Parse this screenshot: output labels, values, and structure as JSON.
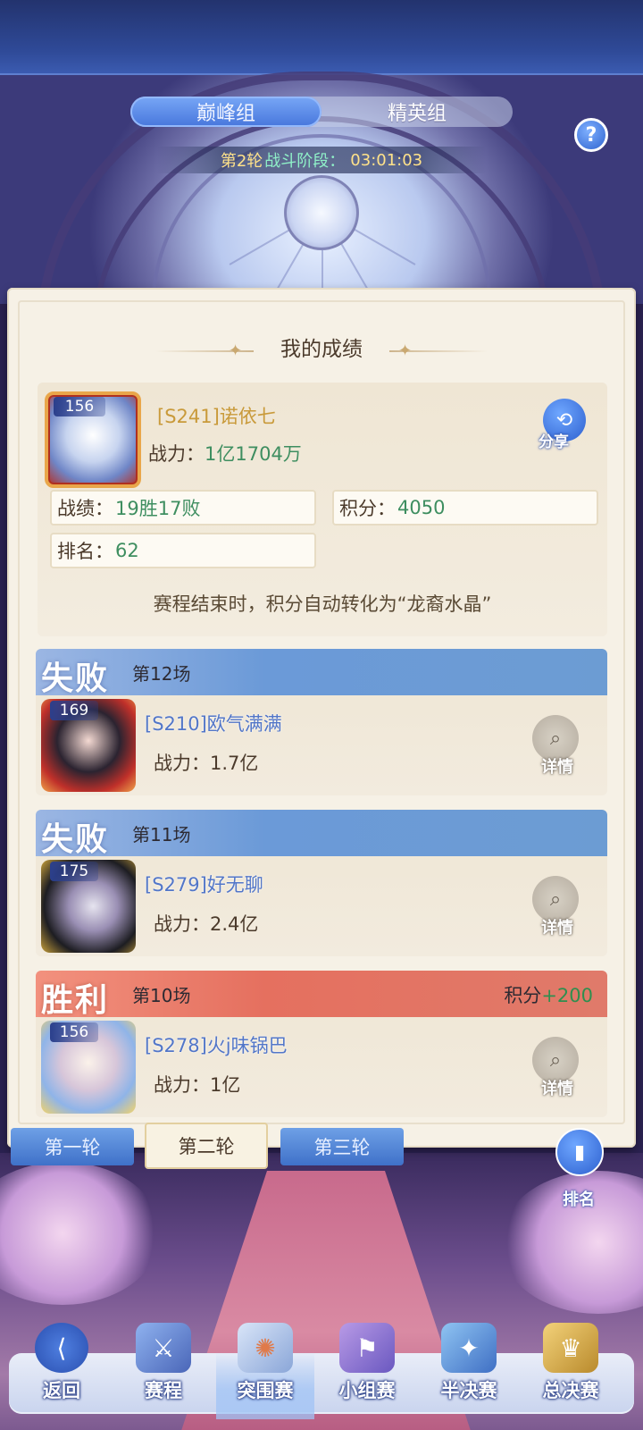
{
  "header": {
    "group_tabs": [
      {
        "label": "巅峰组",
        "active": true
      },
      {
        "label": "精英组",
        "active": false
      }
    ],
    "phase": {
      "round": "第2轮",
      "label": "战斗阶段：",
      "time": "03:01:03"
    },
    "help_icon": "question-icon"
  },
  "my_record": {
    "title": "我的成绩",
    "avatar_level": "156",
    "name": "[S241]诺依七",
    "power_label": "战力：",
    "power_value": "1亿1704万",
    "share_label": "分享",
    "record_label": "战绩：",
    "record_value": "19胜17败",
    "score_label": "积分：",
    "score_value": "4050",
    "rank_label": "排名：",
    "rank_value": "62",
    "note": "赛程结束时，积分自动转化为“龙裔水晶”"
  },
  "matches": [
    {
      "result": "失败",
      "round": "第12场",
      "level": "169",
      "name": "[S210]欧气满满",
      "power": "战力：1.7亿",
      "detail": "详情"
    },
    {
      "result": "失败",
      "round": "第11场",
      "level": "175",
      "name": "[S279]好无聊",
      "power": "战力：2.4亿",
      "detail": "详情"
    },
    {
      "result": "胜利",
      "round": "第10场",
      "level": "156",
      "name": "[S278]火j味锅巴",
      "power": "战力：1亿",
      "detail": "详情",
      "score_label": "积分",
      "score_gain": "+200"
    }
  ],
  "round_tabs": [
    {
      "label": "第一轮",
      "active": false
    },
    {
      "label": "第二轮",
      "active": true
    },
    {
      "label": "第三轮",
      "active": false
    }
  ],
  "rank_button": "排名",
  "bottom_nav": [
    {
      "label": "返回",
      "icon": "back-icon",
      "active": false
    },
    {
      "label": "赛程",
      "icon": "schedule-icon",
      "active": false
    },
    {
      "label": "突围赛",
      "icon": "breakout-icon",
      "active": true
    },
    {
      "label": "小组赛",
      "icon": "group-stage-icon",
      "active": false
    },
    {
      "label": "半决赛",
      "icon": "semifinal-icon",
      "active": false
    },
    {
      "label": "总决赛",
      "icon": "final-icon",
      "active": false
    }
  ],
  "colors": {
    "loss": "#6b9ad8",
    "win": "#e5705f",
    "accent_blue": "#4776dc",
    "value_green": "#3e8e60"
  }
}
